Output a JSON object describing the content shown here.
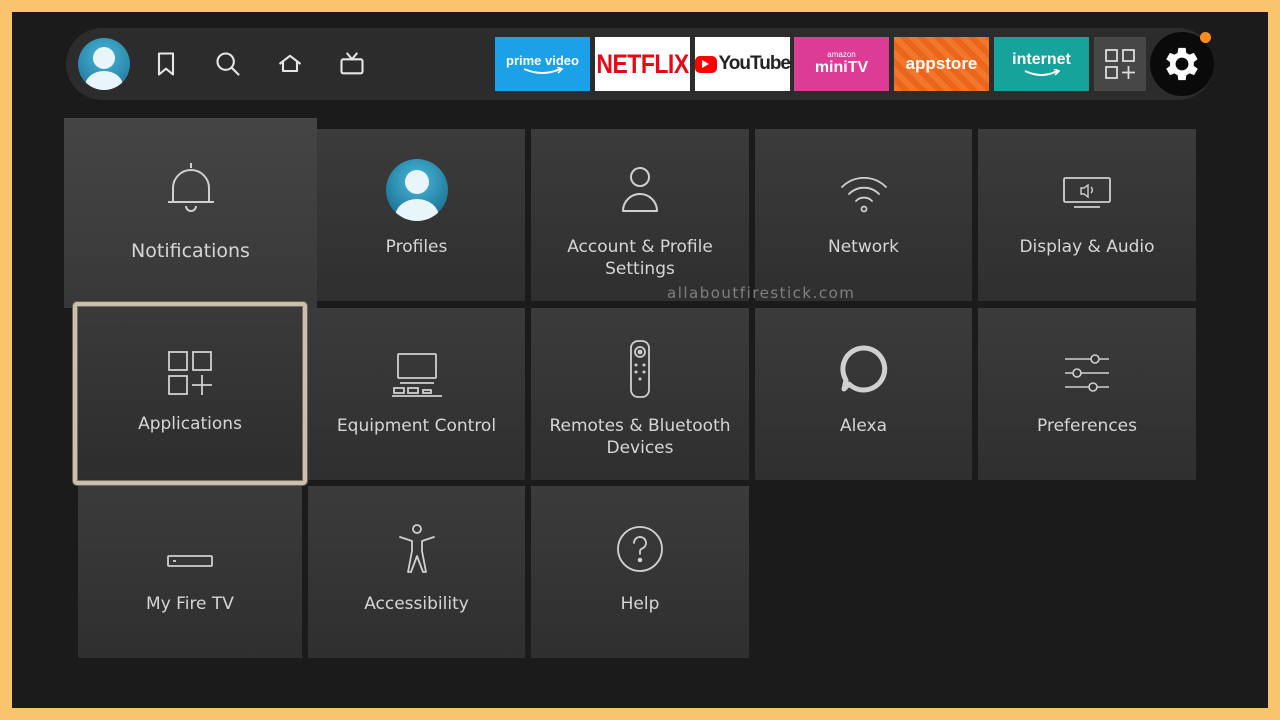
{
  "topbar": {
    "apps": {
      "prime": {
        "label": "prime video"
      },
      "netflix": {
        "label": "NETFLIX"
      },
      "youtube": {
        "label": "YouTube"
      },
      "minitv": {
        "small": "amazon",
        "label": "miniTV"
      },
      "appstore": {
        "label": "appstore"
      },
      "internet": {
        "label": "internet"
      }
    },
    "notification_dot_color": "#ff8a1e"
  },
  "settings": [
    {
      "key": "notifications",
      "label": "Notifications",
      "icon": "bell-icon"
    },
    {
      "key": "profiles",
      "label": "Profiles",
      "icon": "profile-avatar-icon"
    },
    {
      "key": "account",
      "label": "Account & Profile Settings",
      "icon": "person-icon"
    },
    {
      "key": "network",
      "label": "Network",
      "icon": "wifi-icon"
    },
    {
      "key": "display",
      "label": "Display & Audio",
      "icon": "display-audio-icon"
    },
    {
      "key": "applications",
      "label": "Applications",
      "icon": "apps-grid-icon"
    },
    {
      "key": "equipment",
      "label": "Equipment Control",
      "icon": "tv-equipment-icon"
    },
    {
      "key": "remotes",
      "label": "Remotes & Bluetooth Devices",
      "icon": "remote-icon"
    },
    {
      "key": "alexa",
      "label": "Alexa",
      "icon": "alexa-ring-icon"
    },
    {
      "key": "preferences",
      "label": "Preferences",
      "icon": "sliders-icon"
    },
    {
      "key": "myfiretv",
      "label": "My Fire TV",
      "icon": "fire-tv-stick-icon"
    },
    {
      "key": "accessibility",
      "label": "Accessibility",
      "icon": "accessibility-icon"
    },
    {
      "key": "help",
      "label": "Help",
      "icon": "help-icon"
    }
  ],
  "watermark": "allaboutfirestick.com"
}
